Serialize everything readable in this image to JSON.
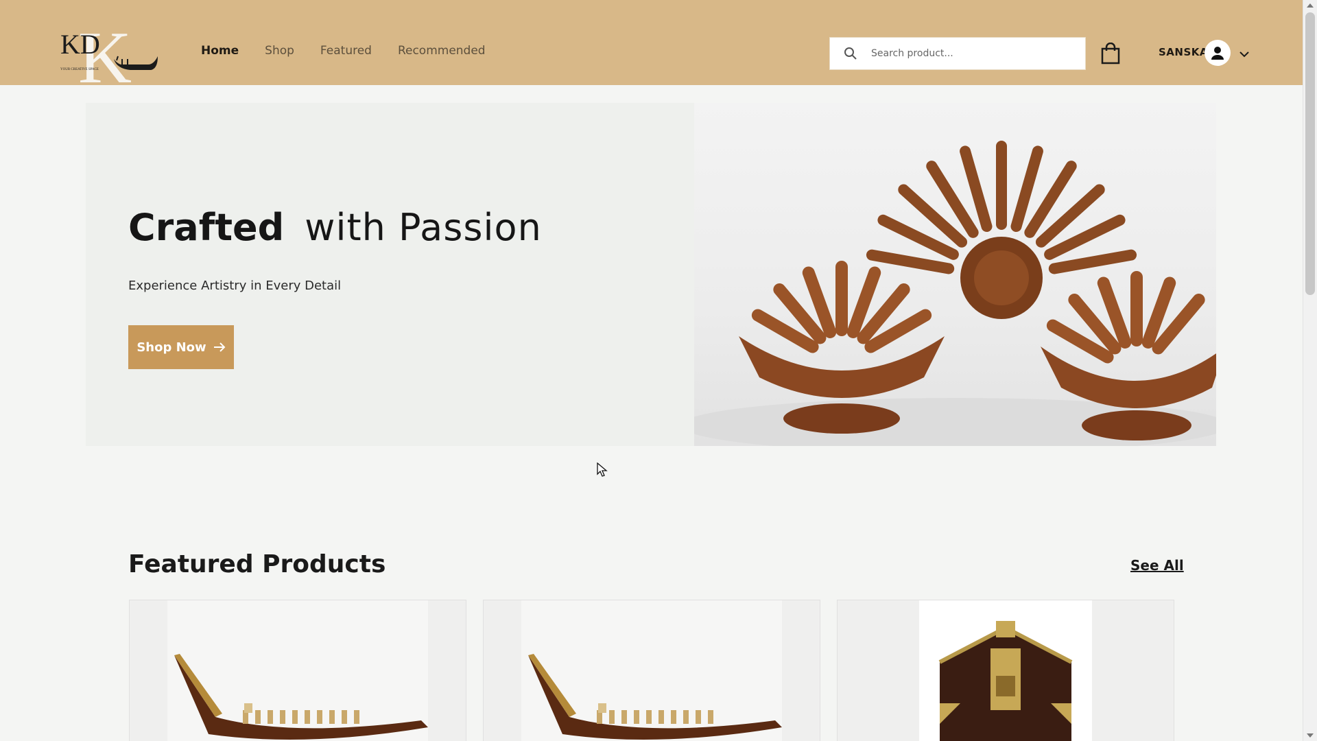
{
  "header": {
    "logo_text": "KD",
    "logo_tagline": "YOUR CREATIVE SPACE",
    "nav": [
      {
        "label": "Home",
        "active": true
      },
      {
        "label": "Shop",
        "active": false
      },
      {
        "label": "Featured",
        "active": false
      },
      {
        "label": "Recommended",
        "active": false
      }
    ],
    "search_placeholder": "Search product...",
    "search_icon": "search-icon",
    "cart_icon": "shopping-bag-icon",
    "user_name": "SANSKA",
    "avatar_icon": "user-icon",
    "menu_icon": "chevron-down-icon"
  },
  "hero": {
    "title_strong": "Crafted",
    "title_light": "with Passion",
    "subtitle": "Experience Artistry in Every Detail",
    "cta_label": "Shop Now",
    "cta_icon": "arrow-right-icon"
  },
  "featured": {
    "title": "Featured Products",
    "see_all": "See All"
  },
  "colors": {
    "header_bg": "#d8b888",
    "accent": "#c8995a",
    "page_bg": "#f4f5f3",
    "hero_bg": "#eef0ed"
  }
}
